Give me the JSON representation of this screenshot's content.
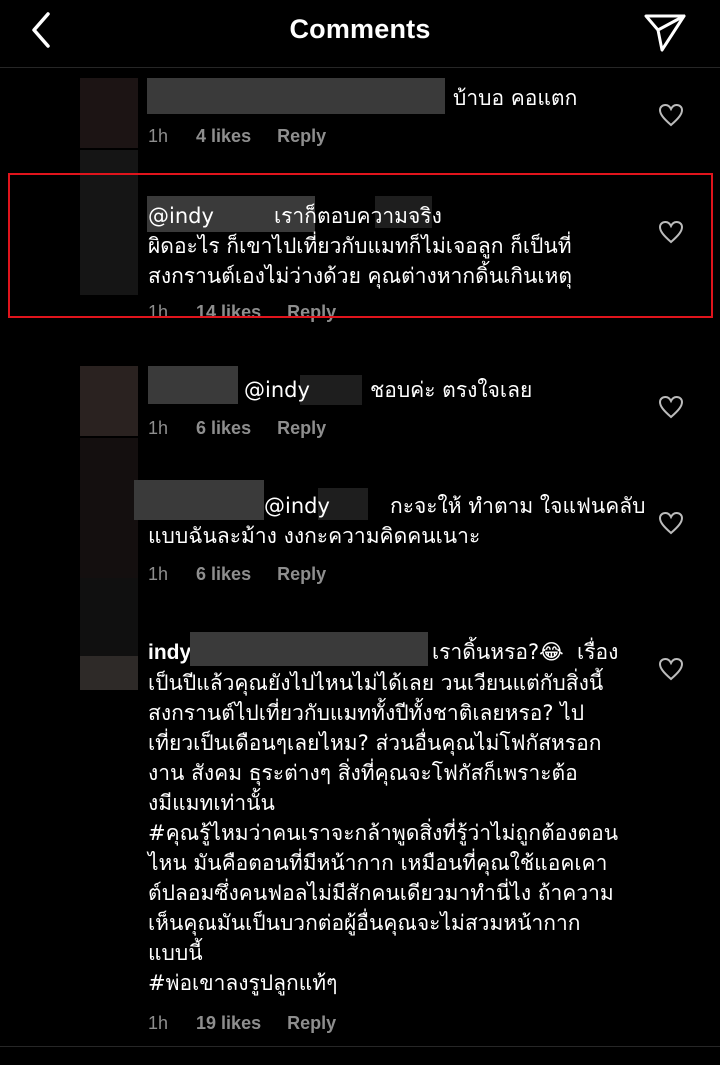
{
  "header": {
    "title": "Comments",
    "back_icon": "chevron-left-icon",
    "send_icon": "paper-plane-icon"
  },
  "comments": [
    {
      "text": "บ้าบอ คอแตก",
      "time": "1h",
      "likes": "4 likes",
      "reply": "Reply"
    },
    {
      "text": "@indy         เราก็ตอบความจริง\nผิดอะไร ก็เขาไปเที่ยวกับแมทก็ไม่เจอลูก ก็เป็นที่\nสงกรานต์เองไม่ว่างด้วย คุณต่างหากดิ้นเกินเหตุ",
      "time": "1h",
      "likes": "14 likes",
      "reply": "Reply",
      "highlighted": true,
      "highlight_color": "#e0141c"
    },
    {
      "text": "@indy         ชอบค่ะ ตรงใจเลย",
      "time": "1h",
      "likes": "6 likes",
      "reply": "Reply"
    },
    {
      "text": "@indy         กะจะให้ ทำตาม ใจแฟนคลับ\nแบบฉันละม้าง งงกะความคิดคนเนาะ",
      "time": "1h",
      "likes": "6 likes",
      "reply": "Reply"
    },
    {
      "username": "indy",
      "text_first": "เราดิ้นหรอ?😂  เรื่อง",
      "text": "เป็นปีแล้วคุณยังไปไหนไม่ได้เลย วนเวียนแต่กับสิ่งนี้\nสงกรานต์ไปเที่ยวกับแมททั้งปีทั้งชาติเลยหรอ? ไป\nเที่ยวเป็นเดือนๆเลยไหม? ส่วนอื่นคุณไม่โฟกัสหรอก\nงาน สังคม ธุระต่างๆ สิ่งที่คุณจะโฟกัสก็เพราะต้อ\nงมีแมทเท่านั้น\n#คุณรู้ไหมว่าคนเราจะกล้าพูดสิ่งที่รู้ว่าไม่ถูกต้องตอน\nไหน มันคือตอนที่มีหน้ากาก เหมือนที่คุณใช้แอคเคา\nต์ปลอมซึ่งคนฟอลไม่มีสักคนเดียวมาทำนี่ไง ถ้าความ\nเห็นคุณมันเป็นบวกต่อผู้อื่นคุณจะไม่สวมหน้ากาก\nแบบนี้\n#พ่อเขาลงรูปลูกแท้ๆ",
      "time": "1h",
      "likes": "19 likes",
      "reply": "Reply"
    }
  ]
}
